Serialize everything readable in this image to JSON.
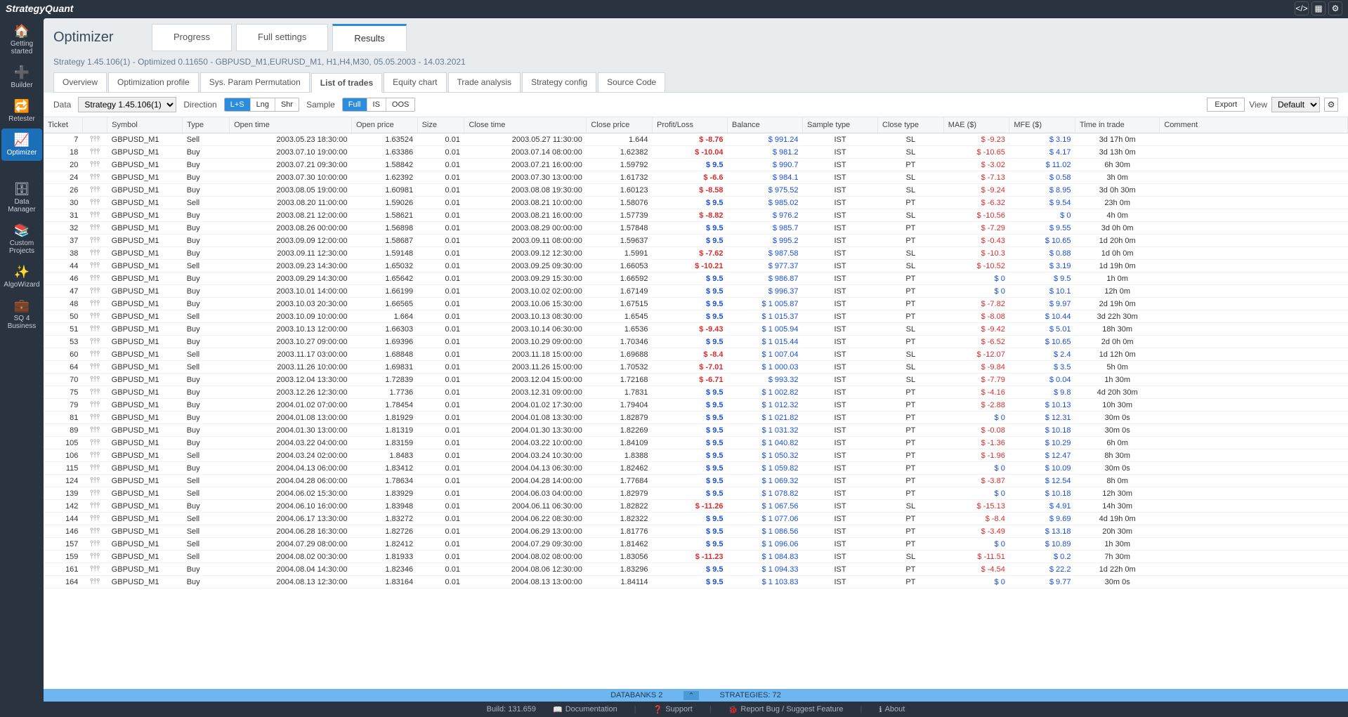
{
  "app_name": "StrategyQuant",
  "page_title": "Optimizer",
  "main_tabs": [
    {
      "label": "Progress",
      "active": false
    },
    {
      "label": "Full settings",
      "active": false
    },
    {
      "label": "Results",
      "active": true
    }
  ],
  "breadcrumb": "Strategy 1.45.106(1) - Optimized 0.11650 - GBPUSD_M1,EURUSD_M1, H1,H4,M30, 05.05.2003 - 14.03.2021",
  "sub_tabs": [
    {
      "label": "Overview",
      "active": false
    },
    {
      "label": "Optimization profile",
      "active": false
    },
    {
      "label": "Sys. Param Permutation",
      "active": false
    },
    {
      "label": "List of trades",
      "active": true
    },
    {
      "label": "Equity chart",
      "active": false
    },
    {
      "label": "Trade analysis",
      "active": false
    },
    {
      "label": "Strategy config",
      "active": false
    },
    {
      "label": "Source Code",
      "active": false
    }
  ],
  "toolbar": {
    "data_label": "Data",
    "data_select": "Strategy 1.45.106(1)",
    "direction_label": "Direction",
    "direction_opts": [
      {
        "label": "L+S",
        "active": true
      },
      {
        "label": "Lng",
        "active": false
      },
      {
        "label": "Shr",
        "active": false
      }
    ],
    "sample_label": "Sample",
    "sample_opts": [
      {
        "label": "Full",
        "active": true
      },
      {
        "label": "IS",
        "active": false
      },
      {
        "label": "OOS",
        "active": false
      }
    ],
    "export_label": "Export",
    "view_label": "View",
    "view_select": "Default"
  },
  "columns": [
    "Ticket",
    "",
    "Symbol",
    "Type",
    "Open time",
    "Open price",
    "Size",
    "Close time",
    "Close price",
    "Profit/Loss",
    "Balance",
    "Sample type",
    "Close type",
    "MAE ($)",
    "MFE ($)",
    "Time in trade",
    "Comment"
  ],
  "rows": [
    {
      "ticket": "7",
      "symbol": "GBPUSD_M1",
      "type": "Sell",
      "otime": "2003.05.23 18:30:00",
      "oprice": "1.63524",
      "size": "0.01",
      "ctime": "2003.05.27 11:30:00",
      "cprice": "1.644",
      "pl": "$ -8.76",
      "bal": "$ 991.24",
      "samp": "IST",
      "ctype": "SL",
      "mae": "$ -9.23",
      "mfe": "$ 3.19",
      "tit": "3d 17h 0m"
    },
    {
      "ticket": "18",
      "symbol": "GBPUSD_M1",
      "type": "Buy",
      "otime": "2003.07.10 19:00:00",
      "oprice": "1.63386",
      "size": "0.01",
      "ctime": "2003.07.14 08:00:00",
      "cprice": "1.62382",
      "pl": "$ -10.04",
      "bal": "$ 981.2",
      "samp": "IST",
      "ctype": "SL",
      "mae": "$ -10.65",
      "mfe": "$ 4.17",
      "tit": "3d 13h 0m"
    },
    {
      "ticket": "20",
      "symbol": "GBPUSD_M1",
      "type": "Buy",
      "otime": "2003.07.21 09:30:00",
      "oprice": "1.58842",
      "size": "0.01",
      "ctime": "2003.07.21 16:00:00",
      "cprice": "1.59792",
      "pl": "$ 9.5",
      "bal": "$ 990.7",
      "samp": "IST",
      "ctype": "PT",
      "mae": "$ -3.02",
      "mfe": "$ 11.02",
      "tit": "6h 30m"
    },
    {
      "ticket": "24",
      "symbol": "GBPUSD_M1",
      "type": "Buy",
      "otime": "2003.07.30 10:00:00",
      "oprice": "1.62392",
      "size": "0.01",
      "ctime": "2003.07.30 13:00:00",
      "cprice": "1.61732",
      "pl": "$ -6.6",
      "bal": "$ 984.1",
      "samp": "IST",
      "ctype": "SL",
      "mae": "$ -7.13",
      "mfe": "$ 0.58",
      "tit": "3h 0m"
    },
    {
      "ticket": "26",
      "symbol": "GBPUSD_M1",
      "type": "Buy",
      "otime": "2003.08.05 19:00:00",
      "oprice": "1.60981",
      "size": "0.01",
      "ctime": "2003.08.08 19:30:00",
      "cprice": "1.60123",
      "pl": "$ -8.58",
      "bal": "$ 975.52",
      "samp": "IST",
      "ctype": "SL",
      "mae": "$ -9.24",
      "mfe": "$ 8.95",
      "tit": "3d 0h 30m"
    },
    {
      "ticket": "30",
      "symbol": "GBPUSD_M1",
      "type": "Sell",
      "otime": "2003.08.20 11:00:00",
      "oprice": "1.59026",
      "size": "0.01",
      "ctime": "2003.08.21 10:00:00",
      "cprice": "1.58076",
      "pl": "$ 9.5",
      "bal": "$ 985.02",
      "samp": "IST",
      "ctype": "PT",
      "mae": "$ -6.32",
      "mfe": "$ 9.54",
      "tit": "23h 0m"
    },
    {
      "ticket": "31",
      "symbol": "GBPUSD_M1",
      "type": "Buy",
      "otime": "2003.08.21 12:00:00",
      "oprice": "1.58621",
      "size": "0.01",
      "ctime": "2003.08.21 16:00:00",
      "cprice": "1.57739",
      "pl": "$ -8.82",
      "bal": "$ 976.2",
      "samp": "IST",
      "ctype": "SL",
      "mae": "$ -10.56",
      "mfe": "$ 0",
      "tit": "4h 0m"
    },
    {
      "ticket": "32",
      "symbol": "GBPUSD_M1",
      "type": "Buy",
      "otime": "2003.08.26 00:00:00",
      "oprice": "1.56898",
      "size": "0.01",
      "ctime": "2003.08.29 00:00:00",
      "cprice": "1.57848",
      "pl": "$ 9.5",
      "bal": "$ 985.7",
      "samp": "IST",
      "ctype": "PT",
      "mae": "$ -7.29",
      "mfe": "$ 9.55",
      "tit": "3d 0h 0m"
    },
    {
      "ticket": "37",
      "symbol": "GBPUSD_M1",
      "type": "Buy",
      "otime": "2003.09.09 12:00:00",
      "oprice": "1.58687",
      "size": "0.01",
      "ctime": "2003.09.11 08:00:00",
      "cprice": "1.59637",
      "pl": "$ 9.5",
      "bal": "$ 995.2",
      "samp": "IST",
      "ctype": "PT",
      "mae": "$ -0.43",
      "mfe": "$ 10.65",
      "tit": "1d 20h 0m"
    },
    {
      "ticket": "38",
      "symbol": "GBPUSD_M1",
      "type": "Buy",
      "otime": "2003.09.11 12:30:00",
      "oprice": "1.59148",
      "size": "0.01",
      "ctime": "2003.09.12 12:30:00",
      "cprice": "1.5991",
      "pl": "$ -7.62",
      "bal": "$ 987.58",
      "samp": "IST",
      "ctype": "SL",
      "mae": "$ -10.3",
      "mfe": "$ 0.88",
      "tit": "1d 0h 0m"
    },
    {
      "ticket": "44",
      "symbol": "GBPUSD_M1",
      "type": "Sell",
      "otime": "2003.09.23 14:30:00",
      "oprice": "1.65032",
      "size": "0.01",
      "ctime": "2003.09.25 09:30:00",
      "cprice": "1.66053",
      "pl": "$ -10.21",
      "bal": "$ 977.37",
      "samp": "IST",
      "ctype": "SL",
      "mae": "$ -10.52",
      "mfe": "$ 3.19",
      "tit": "1d 19h 0m"
    },
    {
      "ticket": "46",
      "symbol": "GBPUSD_M1",
      "type": "Buy",
      "otime": "2003.09.29 14:30:00",
      "oprice": "1.65642",
      "size": "0.01",
      "ctime": "2003.09.29 15:30:00",
      "cprice": "1.66592",
      "pl": "$ 9.5",
      "bal": "$ 986.87",
      "samp": "IST",
      "ctype": "PT",
      "mae": "$ 0",
      "mfe": "$ 9.5",
      "tit": "1h 0m"
    },
    {
      "ticket": "47",
      "symbol": "GBPUSD_M1",
      "type": "Buy",
      "otime": "2003.10.01 14:00:00",
      "oprice": "1.66199",
      "size": "0.01",
      "ctime": "2003.10.02 02:00:00",
      "cprice": "1.67149",
      "pl": "$ 9.5",
      "bal": "$ 996.37",
      "samp": "IST",
      "ctype": "PT",
      "mae": "$ 0",
      "mfe": "$ 10.1",
      "tit": "12h 0m"
    },
    {
      "ticket": "48",
      "symbol": "GBPUSD_M1",
      "type": "Buy",
      "otime": "2003.10.03 20:30:00",
      "oprice": "1.66565",
      "size": "0.01",
      "ctime": "2003.10.06 15:30:00",
      "cprice": "1.67515",
      "pl": "$ 9.5",
      "bal": "$ 1 005.87",
      "samp": "IST",
      "ctype": "PT",
      "mae": "$ -7.82",
      "mfe": "$ 9.97",
      "tit": "2d 19h 0m"
    },
    {
      "ticket": "50",
      "symbol": "GBPUSD_M1",
      "type": "Sell",
      "otime": "2003.10.09 10:00:00",
      "oprice": "1.664",
      "size": "0.01",
      "ctime": "2003.10.13 08:30:00",
      "cprice": "1.6545",
      "pl": "$ 9.5",
      "bal": "$ 1 015.37",
      "samp": "IST",
      "ctype": "PT",
      "mae": "$ -8.08",
      "mfe": "$ 10.44",
      "tit": "3d 22h 30m"
    },
    {
      "ticket": "51",
      "symbol": "GBPUSD_M1",
      "type": "Buy",
      "otime": "2003.10.13 12:00:00",
      "oprice": "1.66303",
      "size": "0.01",
      "ctime": "2003.10.14 06:30:00",
      "cprice": "1.6536",
      "pl": "$ -9.43",
      "bal": "$ 1 005.94",
      "samp": "IST",
      "ctype": "SL",
      "mae": "$ -9.42",
      "mfe": "$ 5.01",
      "tit": "18h 30m"
    },
    {
      "ticket": "53",
      "symbol": "GBPUSD_M1",
      "type": "Buy",
      "otime": "2003.10.27 09:00:00",
      "oprice": "1.69396",
      "size": "0.01",
      "ctime": "2003.10.29 09:00:00",
      "cprice": "1.70346",
      "pl": "$ 9.5",
      "bal": "$ 1 015.44",
      "samp": "IST",
      "ctype": "PT",
      "mae": "$ -6.52",
      "mfe": "$ 10.65",
      "tit": "2d 0h 0m"
    },
    {
      "ticket": "60",
      "symbol": "GBPUSD_M1",
      "type": "Sell",
      "otime": "2003.11.17 03:00:00",
      "oprice": "1.68848",
      "size": "0.01",
      "ctime": "2003.11.18 15:00:00",
      "cprice": "1.69688",
      "pl": "$ -8.4",
      "bal": "$ 1 007.04",
      "samp": "IST",
      "ctype": "SL",
      "mae": "$ -12.07",
      "mfe": "$ 2.4",
      "tit": "1d 12h 0m"
    },
    {
      "ticket": "64",
      "symbol": "GBPUSD_M1",
      "type": "Sell",
      "otime": "2003.11.26 10:00:00",
      "oprice": "1.69831",
      "size": "0.01",
      "ctime": "2003.11.26 15:00:00",
      "cprice": "1.70532",
      "pl": "$ -7.01",
      "bal": "$ 1 000.03",
      "samp": "IST",
      "ctype": "SL",
      "mae": "$ -9.84",
      "mfe": "$ 3.5",
      "tit": "5h 0m"
    },
    {
      "ticket": "70",
      "symbol": "GBPUSD_M1",
      "type": "Buy",
      "otime": "2003.12.04 13:30:00",
      "oprice": "1.72839",
      "size": "0.01",
      "ctime": "2003.12.04 15:00:00",
      "cprice": "1.72168",
      "pl": "$ -6.71",
      "bal": "$ 993.32",
      "samp": "IST",
      "ctype": "SL",
      "mae": "$ -7.79",
      "mfe": "$ 0.04",
      "tit": "1h 30m"
    },
    {
      "ticket": "75",
      "symbol": "GBPUSD_M1",
      "type": "Buy",
      "otime": "2003.12.26 12:30:00",
      "oprice": "1.7736",
      "size": "0.01",
      "ctime": "2003.12.31 09:00:00",
      "cprice": "1.7831",
      "pl": "$ 9.5",
      "bal": "$ 1 002.82",
      "samp": "IST",
      "ctype": "PT",
      "mae": "$ -4.16",
      "mfe": "$ 9.8",
      "tit": "4d 20h 30m"
    },
    {
      "ticket": "79",
      "symbol": "GBPUSD_M1",
      "type": "Buy",
      "otime": "2004.01.02 07:00:00",
      "oprice": "1.78454",
      "size": "0.01",
      "ctime": "2004.01.02 17:30:00",
      "cprice": "1.79404",
      "pl": "$ 9.5",
      "bal": "$ 1 012.32",
      "samp": "IST",
      "ctype": "PT",
      "mae": "$ -2.88",
      "mfe": "$ 10.13",
      "tit": "10h 30m"
    },
    {
      "ticket": "81",
      "symbol": "GBPUSD_M1",
      "type": "Buy",
      "otime": "2004.01.08 13:00:00",
      "oprice": "1.81929",
      "size": "0.01",
      "ctime": "2004.01.08 13:30:00",
      "cprice": "1.82879",
      "pl": "$ 9.5",
      "bal": "$ 1 021.82",
      "samp": "IST",
      "ctype": "PT",
      "mae": "$ 0",
      "mfe": "$ 12.31",
      "tit": "30m 0s"
    },
    {
      "ticket": "89",
      "symbol": "GBPUSD_M1",
      "type": "Buy",
      "otime": "2004.01.30 13:00:00",
      "oprice": "1.81319",
      "size": "0.01",
      "ctime": "2004.01.30 13:30:00",
      "cprice": "1.82269",
      "pl": "$ 9.5",
      "bal": "$ 1 031.32",
      "samp": "IST",
      "ctype": "PT",
      "mae": "$ -0.08",
      "mfe": "$ 10.18",
      "tit": "30m 0s"
    },
    {
      "ticket": "105",
      "symbol": "GBPUSD_M1",
      "type": "Buy",
      "otime": "2004.03.22 04:00:00",
      "oprice": "1.83159",
      "size": "0.01",
      "ctime": "2004.03.22 10:00:00",
      "cprice": "1.84109",
      "pl": "$ 9.5",
      "bal": "$ 1 040.82",
      "samp": "IST",
      "ctype": "PT",
      "mae": "$ -1.36",
      "mfe": "$ 10.29",
      "tit": "6h 0m"
    },
    {
      "ticket": "106",
      "symbol": "GBPUSD_M1",
      "type": "Sell",
      "otime": "2004.03.24 02:00:00",
      "oprice": "1.8483",
      "size": "0.01",
      "ctime": "2004.03.24 10:30:00",
      "cprice": "1.8388",
      "pl": "$ 9.5",
      "bal": "$ 1 050.32",
      "samp": "IST",
      "ctype": "PT",
      "mae": "$ -1.96",
      "mfe": "$ 12.47",
      "tit": "8h 30m"
    },
    {
      "ticket": "115",
      "symbol": "GBPUSD_M1",
      "type": "Buy",
      "otime": "2004.04.13 06:00:00",
      "oprice": "1.83412",
      "size": "0.01",
      "ctime": "2004.04.13 06:30:00",
      "cprice": "1.82462",
      "pl": "$ 9.5",
      "bal": "$ 1 059.82",
      "samp": "IST",
      "ctype": "PT",
      "mae": "$ 0",
      "mfe": "$ 10.09",
      "tit": "30m 0s"
    },
    {
      "ticket": "124",
      "symbol": "GBPUSD_M1",
      "type": "Sell",
      "otime": "2004.04.28 06:00:00",
      "oprice": "1.78634",
      "size": "0.01",
      "ctime": "2004.04.28 14:00:00",
      "cprice": "1.77684",
      "pl": "$ 9.5",
      "bal": "$ 1 069.32",
      "samp": "IST",
      "ctype": "PT",
      "mae": "$ -3.87",
      "mfe": "$ 12.54",
      "tit": "8h 0m"
    },
    {
      "ticket": "139",
      "symbol": "GBPUSD_M1",
      "type": "Sell",
      "otime": "2004.06.02 15:30:00",
      "oprice": "1.83929",
      "size": "0.01",
      "ctime": "2004.06.03 04:00:00",
      "cprice": "1.82979",
      "pl": "$ 9.5",
      "bal": "$ 1 078.82",
      "samp": "IST",
      "ctype": "PT",
      "mae": "$ 0",
      "mfe": "$ 10.18",
      "tit": "12h 30m"
    },
    {
      "ticket": "142",
      "symbol": "GBPUSD_M1",
      "type": "Buy",
      "otime": "2004.06.10 16:00:00",
      "oprice": "1.83948",
      "size": "0.01",
      "ctime": "2004.06.11 06:30:00",
      "cprice": "1.82822",
      "pl": "$ -11.26",
      "bal": "$ 1 067.56",
      "samp": "IST",
      "ctype": "SL",
      "mae": "$ -15.13",
      "mfe": "$ 4.91",
      "tit": "14h 30m"
    },
    {
      "ticket": "144",
      "symbol": "GBPUSD_M1",
      "type": "Sell",
      "otime": "2004.06.17 13:30:00",
      "oprice": "1.83272",
      "size": "0.01",
      "ctime": "2004.06.22 08:30:00",
      "cprice": "1.82322",
      "pl": "$ 9.5",
      "bal": "$ 1 077.06",
      "samp": "IST",
      "ctype": "PT",
      "mae": "$ -8.4",
      "mfe": "$ 9.69",
      "tit": "4d 19h 0m"
    },
    {
      "ticket": "146",
      "symbol": "GBPUSD_M1",
      "type": "Sell",
      "otime": "2004.06.28 16:30:00",
      "oprice": "1.82726",
      "size": "0.01",
      "ctime": "2004.06.29 13:00:00",
      "cprice": "1.81776",
      "pl": "$ 9.5",
      "bal": "$ 1 086.56",
      "samp": "IST",
      "ctype": "PT",
      "mae": "$ -3.49",
      "mfe": "$ 13.18",
      "tit": "20h 30m"
    },
    {
      "ticket": "157",
      "symbol": "GBPUSD_M1",
      "type": "Sell",
      "otime": "2004.07.29 08:00:00",
      "oprice": "1.82412",
      "size": "0.01",
      "ctime": "2004.07.29 09:30:00",
      "cprice": "1.81462",
      "pl": "$ 9.5",
      "bal": "$ 1 096.06",
      "samp": "IST",
      "ctype": "PT",
      "mae": "$ 0",
      "mfe": "$ 10.89",
      "tit": "1h 30m"
    },
    {
      "ticket": "159",
      "symbol": "GBPUSD_M1",
      "type": "Sell",
      "otime": "2004.08.02 00:30:00",
      "oprice": "1.81933",
      "size": "0.01",
      "ctime": "2004.08.02 08:00:00",
      "cprice": "1.83056",
      "pl": "$ -11.23",
      "bal": "$ 1 084.83",
      "samp": "IST",
      "ctype": "SL",
      "mae": "$ -11.51",
      "mfe": "$ 0.2",
      "tit": "7h 30m"
    },
    {
      "ticket": "161",
      "symbol": "GBPUSD_M1",
      "type": "Buy",
      "otime": "2004.08.04 14:30:00",
      "oprice": "1.82346",
      "size": "0.01",
      "ctime": "2004.08.06 12:30:00",
      "cprice": "1.83296",
      "pl": "$ 9.5",
      "bal": "$ 1 094.33",
      "samp": "IST",
      "ctype": "PT",
      "mae": "$ -4.54",
      "mfe": "$ 22.2",
      "tit": "1d 22h 0m"
    },
    {
      "ticket": "164",
      "symbol": "GBPUSD_M1",
      "type": "Buy",
      "otime": "2004.08.13 12:30:00",
      "oprice": "1.83164",
      "size": "0.01",
      "ctime": "2004.08.13 13:00:00",
      "cprice": "1.84114",
      "pl": "$ 9.5",
      "bal": "$ 1 103.83",
      "samp": "IST",
      "ctype": "PT",
      "mae": "$ 0",
      "mfe": "$ 9.77",
      "tit": "30m 0s"
    }
  ],
  "sidebar": [
    {
      "icon": "🏠",
      "label": "Getting started",
      "active": false
    },
    {
      "icon": "➕",
      "label": "Builder",
      "active": false
    },
    {
      "icon": "🔁",
      "label": "Retester",
      "active": false
    },
    {
      "icon": "📈",
      "label": "Optimizer",
      "active": true
    },
    {
      "icon": "🗄",
      "label": "Data Manager",
      "active": false
    },
    {
      "icon": "📚",
      "label": "Custom Projects",
      "active": false
    },
    {
      "icon": "✨",
      "label": "AlgoWizard",
      "active": false
    },
    {
      "icon": "💼",
      "label": "SQ 4 Business",
      "active": false
    }
  ],
  "statusbar": {
    "databanks": "DATABANKS 2",
    "strategies": "STRATEGIES: 72"
  },
  "footer": {
    "build": "Build: 131.659",
    "docs": "Documentation",
    "support": "Support",
    "bug": "Report Bug / Suggest Feature",
    "about": "About"
  }
}
